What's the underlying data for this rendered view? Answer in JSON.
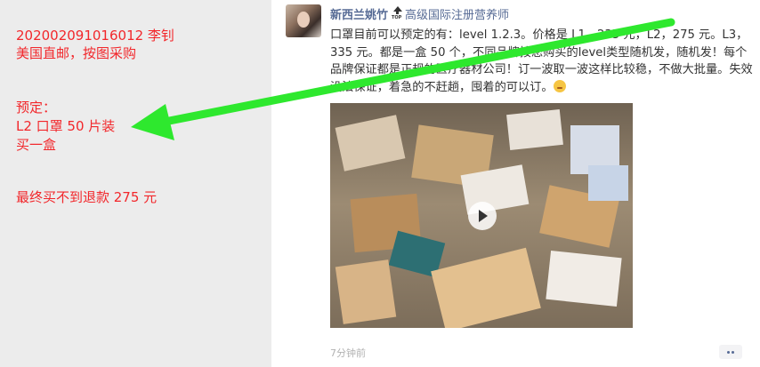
{
  "annotation": {
    "order_line": "202002091016012   李钊",
    "purchase_line": "美国直邮，按图采购",
    "reserve_label": "预定：",
    "item_line": "L2 口罩 50 片装",
    "quantity_line": "买一盒",
    "result_line": "最终买不到退款 275 元"
  },
  "post": {
    "username": "新西兰姚竹",
    "top_badge": "TOP",
    "title": "高级国际注册营养师",
    "text": "口罩目前可以预定的有：level 1.2.3。价格是 L1，235 元，L2，275 元。L3，335 元。都是一盒 50 个，不同品牌按您购买的level类型随机发，随机发！每个品牌保证都是正规的医疗器材公司！订一波取一波这样比较稳，不做大批量。失效没法保证，着急的不赶趟，囤着的可以订。",
    "time": "7分钟前"
  },
  "icons": {
    "avatar": "profile-photo",
    "play": "play-icon",
    "more": "more-dots-icon",
    "arrow": "annotation-arrow"
  },
  "colors": {
    "annotation_red": "#f2272b",
    "link_blue": "#576b95",
    "arrow_green": "#2ee82e"
  }
}
